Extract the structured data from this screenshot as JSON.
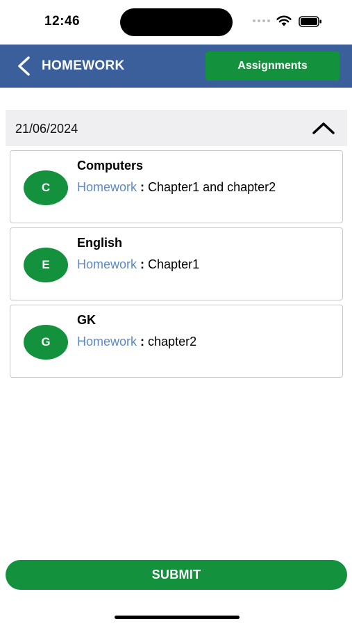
{
  "status_bar": {
    "time": "12:46"
  },
  "header": {
    "title": "HOMEWORK",
    "assignments_label": "Assignments"
  },
  "date_section": {
    "date": "21/06/2024"
  },
  "homework_items": [
    {
      "initial": "C",
      "subject": "Computers",
      "link_label": "Homework",
      "separator": " : ",
      "detail": "Chapter1 and chapter2"
    },
    {
      "initial": "E",
      "subject": "English",
      "link_label": "Homework",
      "separator": " : ",
      "detail": "Chapter1"
    },
    {
      "initial": "G",
      "subject": "GK",
      "link_label": "Homework",
      "separator": " : ",
      "detail": "chapter2"
    }
  ],
  "submit_label": "SUBMIT",
  "colors": {
    "header_bg": "#3a5f9b",
    "accent_green": "#13913d",
    "link_blue": "#5c8ac9",
    "date_bg": "#efeff2"
  },
  "icons": {
    "back": "chevron-left-icon",
    "collapse": "chevron-up-icon",
    "wifi": "wifi-icon",
    "battery": "battery-icon"
  }
}
